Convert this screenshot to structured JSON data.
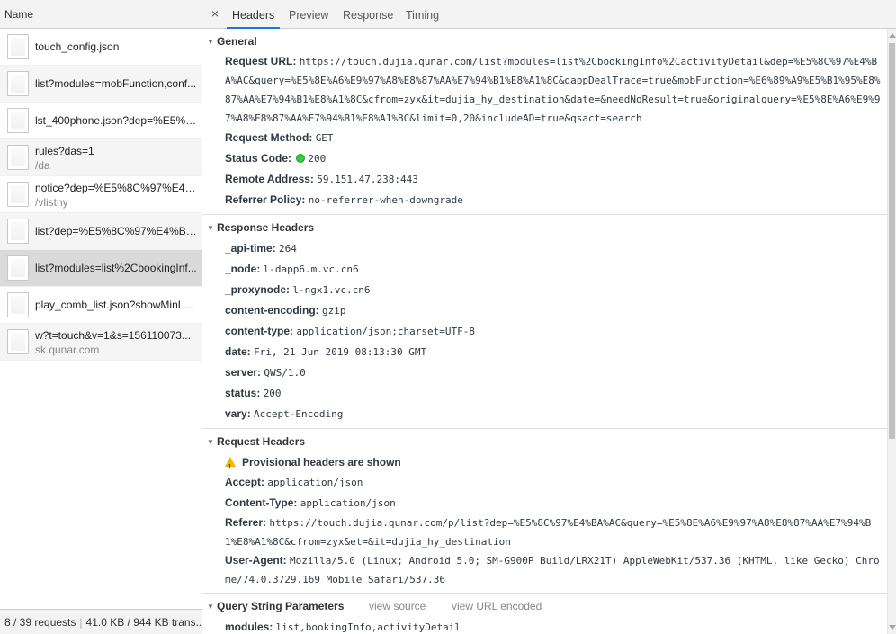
{
  "list": {
    "header": "Name",
    "requests": [
      {
        "name": "touch_config.json",
        "sub": ""
      },
      {
        "name": "list?modules=mobFunction,conf...",
        "sub": ""
      },
      {
        "name": "lst_400phone.json?dep=%E5%8...",
        "sub": ""
      },
      {
        "name": "rules?das=1",
        "sub": "/da"
      },
      {
        "name": "notice?dep=%E5%8C%97%E4%...",
        "sub": "/vlistny"
      },
      {
        "name": "list?dep=%E5%8C%97%E4%BA...",
        "sub": ""
      },
      {
        "name": "list?modules=list%2CbookingInf...",
        "sub": "",
        "selected": true
      },
      {
        "name": "play_comb_list.json?showMinLin...",
        "sub": ""
      },
      {
        "name": "w?t=touch&v=1&s=156110073...",
        "sub": "sk.qunar.com"
      }
    ],
    "status_requests": "8 / 39 requests",
    "status_sep": "|",
    "status_size": "41.0 KB / 944 KB trans..."
  },
  "tabs": {
    "close": "×",
    "headers": "Headers",
    "preview": "Preview",
    "response": "Response",
    "timing": "Timing"
  },
  "general": {
    "title": "General",
    "request_url_key": "Request URL:",
    "request_url": "https://touch.dujia.qunar.com/list?modules=list%2CbookingInfo%2CactivityDetail&dep=%E5%8C%97%E4%BA%AC&query=%E5%8E%A6%E9%97%A8%E8%87%AA%E7%94%B1%E8%A1%8C&dappDealTrace=true&mobFunction=%E6%89%A9%E5%B1%95%E8%87%AA%E7%94%B1%E8%A1%8C&cfrom=zyx&it=dujia_hy_destination&date=&needNoResult=true&originalquery=%E5%8E%A6%E9%97%A8%E8%87%AA%E7%94%B1%E8%A1%8C&limit=0,20&includeAD=true&qsact=search",
    "method_key": "Request Method:",
    "method": "GET",
    "status_key": "Status Code:",
    "status": "200",
    "remote_key": "Remote Address:",
    "remote": "59.151.47.238:443",
    "referrer_key": "Referrer Policy:",
    "referrer": "no-referrer-when-downgrade"
  },
  "response_headers": {
    "title": "Response Headers",
    "items": [
      {
        "k": "_api-time:",
        "v": "264"
      },
      {
        "k": "_node:",
        "v": "l-dapp6.m.vc.cn6"
      },
      {
        "k": "_proxynode:",
        "v": "l-ngx1.vc.cn6"
      },
      {
        "k": "content-encoding:",
        "v": "gzip"
      },
      {
        "k": "content-type:",
        "v": "application/json;charset=UTF-8"
      },
      {
        "k": "date:",
        "v": "Fri, 21 Jun 2019 08:13:30 GMT"
      },
      {
        "k": "server:",
        "v": "QWS/1.0"
      },
      {
        "k": "status:",
        "v": "200"
      },
      {
        "k": "vary:",
        "v": "Accept-Encoding"
      }
    ]
  },
  "request_headers": {
    "title": "Request Headers",
    "warning": "Provisional headers are shown",
    "items": [
      {
        "k": "Accept:",
        "v": "application/json"
      },
      {
        "k": "Content-Type:",
        "v": "application/json"
      },
      {
        "k": "Referer:",
        "v": "https://touch.dujia.qunar.com/p/list?dep=%E5%8C%97%E4%BA%AC&query=%E5%8E%A6%E9%97%A8%E8%87%AA%E7%94%B1%E8%A1%8C&cfrom=zyx&et=&it=dujia_hy_destination"
      },
      {
        "k": "User-Agent:",
        "v": "Mozilla/5.0 (Linux; Android 5.0; SM-G900P Build/LRX21T) AppleWebKit/537.36 (KHTML, like Gecko) Chrome/74.0.3729.169 Mobile Safari/537.36"
      }
    ]
  },
  "query_params": {
    "title": "Query String Parameters",
    "view_source": "view source",
    "view_encoded": "view URL encoded",
    "items": [
      {
        "k": "modules:",
        "v": "list,bookingInfo,activityDetail"
      }
    ]
  }
}
